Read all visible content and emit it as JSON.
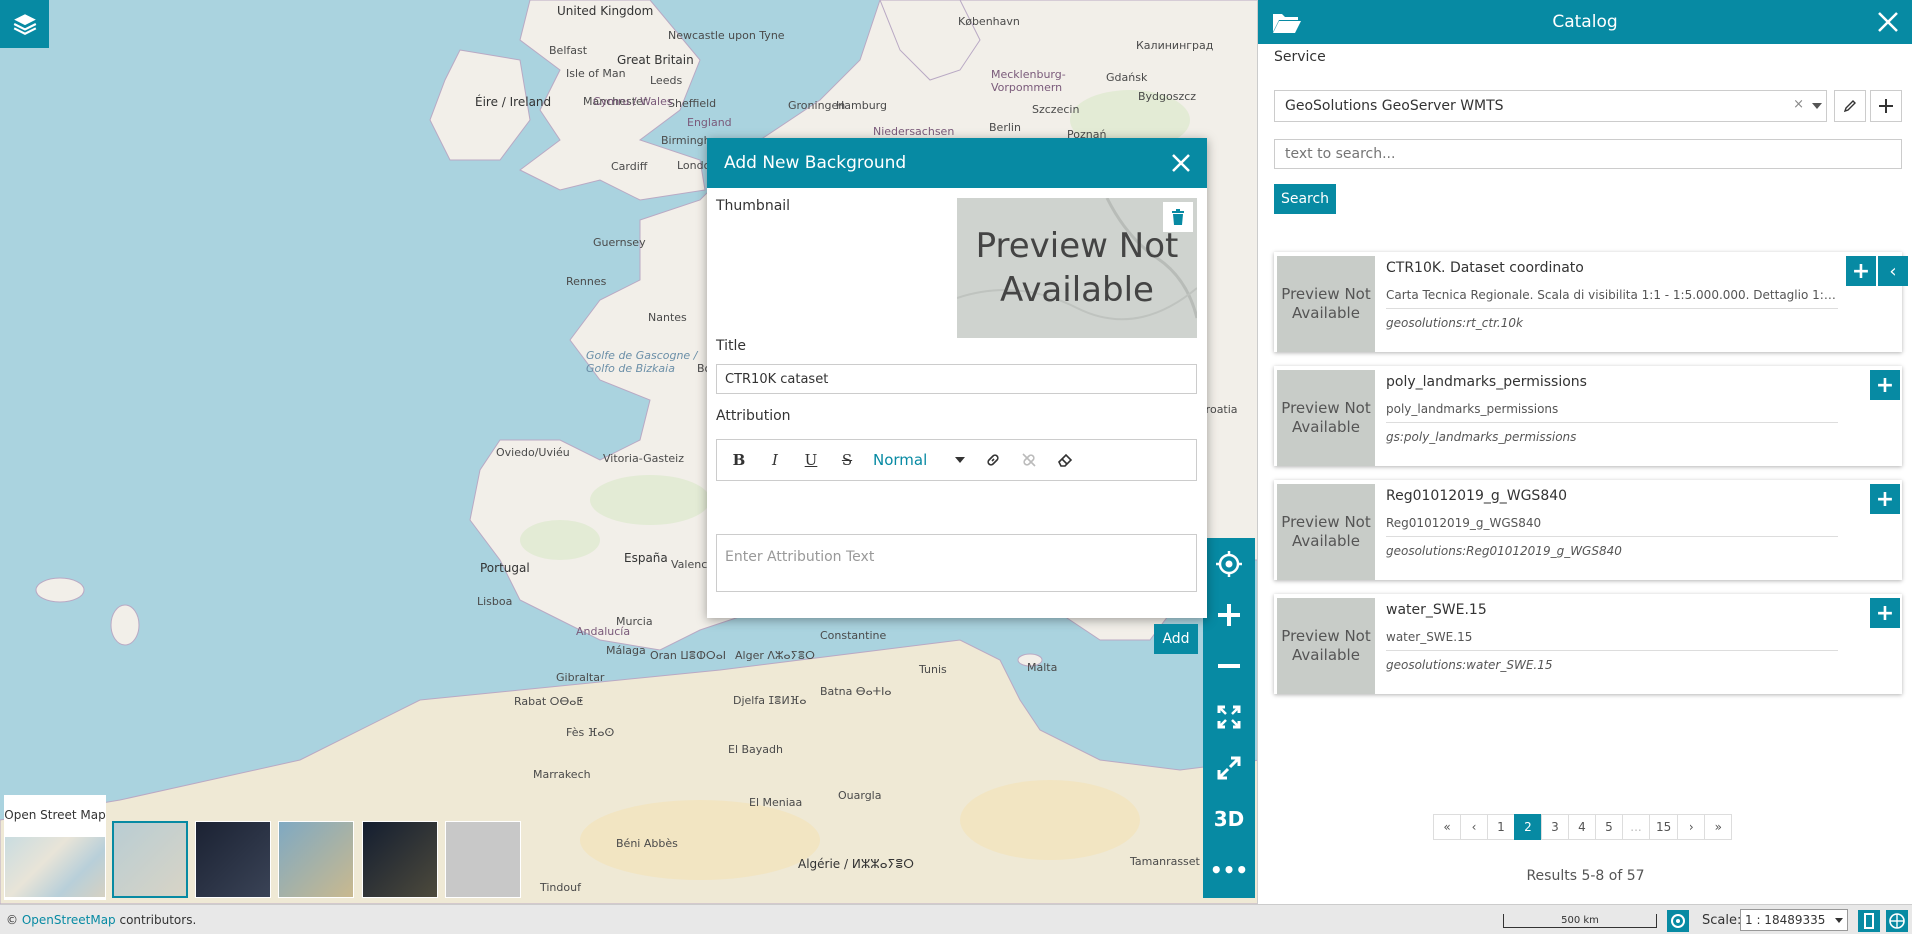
{
  "map": {
    "labels": [
      {
        "text": "United Kingdom",
        "kind": "big"
      },
      {
        "text": "Newcastle upon Tyne",
        "kind": ""
      },
      {
        "text": "Belfast",
        "kind": ""
      },
      {
        "text": "Great Britain",
        "kind": "big"
      },
      {
        "text": "Isle of Man",
        "kind": ""
      },
      {
        "text": "Leeds",
        "kind": ""
      },
      {
        "text": "Éire / Ireland",
        "kind": "big"
      },
      {
        "text": "Manchester",
        "kind": ""
      },
      {
        "text": "Sheffield",
        "kind": ""
      },
      {
        "text": "England",
        "kind": "country"
      },
      {
        "text": "Cymru / Wales",
        "kind": "country"
      },
      {
        "text": "Birmingham",
        "kind": ""
      },
      {
        "text": "Cardiff",
        "kind": ""
      },
      {
        "text": "London",
        "kind": ""
      },
      {
        "text": "Guernsey",
        "kind": ""
      },
      {
        "text": "Rennes",
        "kind": ""
      },
      {
        "text": "Nantes",
        "kind": ""
      },
      {
        "text": "Golfe de Gascogne / Golfo de Bizkaia",
        "kind": "sea"
      },
      {
        "text": "Bordeaux",
        "kind": ""
      },
      {
        "text": "Oviedo/Uviéu",
        "kind": ""
      },
      {
        "text": "Vitoria-Gasteiz",
        "kind": ""
      },
      {
        "text": "Portugal",
        "kind": "big"
      },
      {
        "text": "España",
        "kind": "big"
      },
      {
        "text": "Lisboa",
        "kind": ""
      },
      {
        "text": "Valencia",
        "kind": ""
      },
      {
        "text": "Andalucía",
        "kind": "country"
      },
      {
        "text": "Murcia",
        "kind": ""
      },
      {
        "text": "Málaga",
        "kind": ""
      },
      {
        "text": "Gibraltar",
        "kind": ""
      },
      {
        "text": "Rabat ⵔⴱⴰⵟ",
        "kind": ""
      },
      {
        "text": "Fès ⴼⴰⵙ",
        "kind": ""
      },
      {
        "text": "Marrakech",
        "kind": ""
      },
      {
        "text": "Oran ⵡⴻⵀⵔⴰⵏ",
        "kind": ""
      },
      {
        "text": "Alger ⴷⵣⴰⵢⴻⵔ",
        "kind": ""
      },
      {
        "text": "Djelfa ⵊⴻⵍⴼⴰ",
        "kind": ""
      },
      {
        "text": "Batna ⴱⴰⵜⵏⴰ",
        "kind": ""
      },
      {
        "text": "Algérie / ⵍⵣⵣⴰⵢⴻⵔ",
        "kind": "big"
      },
      {
        "text": "Tunis",
        "kind": ""
      },
      {
        "text": "Malta",
        "kind": ""
      },
      {
        "text": "Constantine",
        "kind": ""
      },
      {
        "text": "El Bayadh",
        "kind": ""
      },
      {
        "text": "El Meniaa",
        "kind": ""
      },
      {
        "text": "Ouargla",
        "kind": ""
      },
      {
        "text": "Groningen",
        "kind": ""
      },
      {
        "text": "Hamburg",
        "kind": ""
      },
      {
        "text": "Berlin",
        "kind": ""
      },
      {
        "text": "Szczecin",
        "kind": ""
      },
      {
        "text": "Poznań",
        "kind": ""
      },
      {
        "text": "Gdańsk",
        "kind": ""
      },
      {
        "text": "København",
        "kind": ""
      },
      {
        "text": "Mecklenburg-Vorpommern",
        "kind": "country"
      },
      {
        "text": "Niedersachsen",
        "kind": "country"
      },
      {
        "text": "Калининград",
        "kind": ""
      },
      {
        "text": "Bydgoszcz",
        "kind": ""
      },
      {
        "text": "Croatia",
        "kind": ""
      },
      {
        "text": "Tindouf",
        "kind": ""
      },
      {
        "text": "Béni Abbès",
        "kind": ""
      },
      {
        "text": "Tamanrasset",
        "kind": ""
      }
    ]
  },
  "dialog": {
    "title": "Add New Background",
    "thumbnail_label": "Thumbnail",
    "thumbnail_preview": "Preview Not Available",
    "title_label": "Title",
    "title_value": "CTR10K cataset",
    "attribution_label": "Attribution",
    "toolbar": {
      "bold": "B",
      "italic": "I",
      "underline": "U",
      "strike": "S",
      "size_select": "Normal"
    },
    "attribution_placeholder": "Enter Attribution Text",
    "add_label": "Add"
  },
  "map_tools": {
    "three_d": "3D",
    "more": "•••"
  },
  "background_selector": {
    "current_label": "Open Street Map",
    "thumbnails": [
      {
        "name": "bg-thumb-1",
        "colors": [
          "#b9cdd3",
          "#d8d4c6"
        ]
      },
      {
        "name": "bg-thumb-2",
        "colors": [
          "#1b2233",
          "#3a4356"
        ]
      },
      {
        "name": "bg-thumb-3",
        "colors": [
          "#7fa9c2",
          "#c9b98f"
        ]
      },
      {
        "name": "bg-thumb-4",
        "colors": [
          "#141e30",
          "#4d4a3c"
        ]
      },
      {
        "name": "bg-thumb-5",
        "colors": [
          "#c8c8c8",
          "#c8c8c8"
        ]
      }
    ]
  },
  "catalog": {
    "title": "Catalog",
    "service_label": "Service",
    "service_value": "GeoSolutions GeoServer WMTS",
    "search_placeholder": "text to search...",
    "search_button": "Search",
    "records": [
      {
        "thumb": "Preview Not Available",
        "title": "CTR10K. Dataset coordinato",
        "description": "Carta Tecnica Regionale. Scala di visibilita 1:1 - 1:5.000.000. Dettaglio 1:1...",
        "name": "geosolutions:rt_ctr.10k",
        "has_back": true
      },
      {
        "thumb": "Preview Not Available",
        "title": "poly_landmarks_permissions",
        "description": "poly_landmarks_permissions",
        "name": "gs:poly_landmarks_permissions",
        "has_back": false
      },
      {
        "thumb": "Preview Not Available",
        "title": "Reg01012019_g_WGS840",
        "description": "Reg01012019_g_WGS840",
        "name": "geosolutions:Reg01012019_g_WGS840",
        "has_back": false
      },
      {
        "thumb": "Preview Not Available",
        "title": "water_SWE.15",
        "description": "water_SWE.15",
        "name": "geosolutions:water_SWE.15",
        "has_back": false
      }
    ],
    "pagination": [
      "«",
      "‹",
      "1",
      "2",
      "3",
      "4",
      "5",
      "...",
      "15",
      "›",
      "»"
    ],
    "active_page": "2",
    "results": "Results 5-8 of 57"
  },
  "footer": {
    "attribution_prefix": "© ",
    "attribution_link": "OpenStreetMap",
    "attribution_suffix": " contributors.",
    "scalebar": "500 km",
    "scale_label": "Scale:",
    "scale_value": "1 : 18489335"
  },
  "colors": {
    "accent": "#078aa3",
    "sea": "#aad3df",
    "land": "#f2efe9"
  }
}
